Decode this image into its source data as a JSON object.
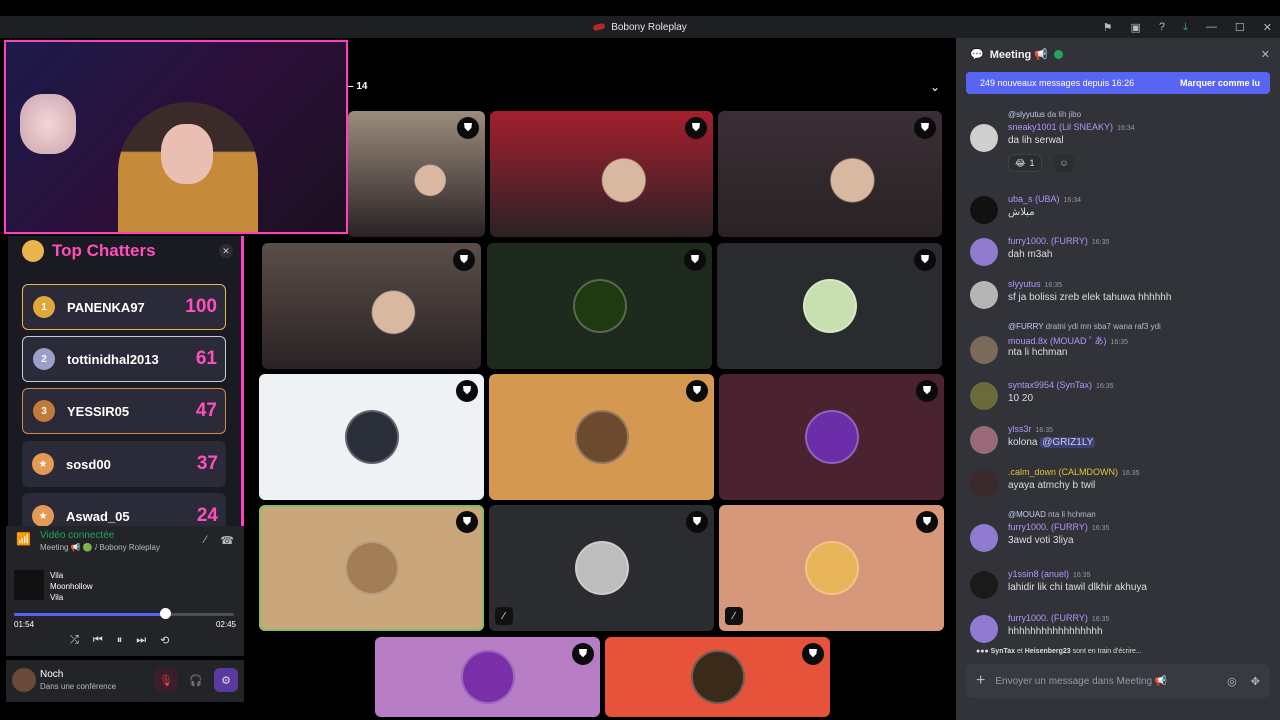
{
  "window": {
    "title": "Bobony Roleplay"
  },
  "stage": {
    "participant_count": "14",
    "tiles": [
      {
        "kind": "video",
        "bg": "#9b8c7d",
        "muted": false
      },
      {
        "kind": "video",
        "bg": "#a41f2e",
        "muted": false
      },
      {
        "kind": "video",
        "bg": "#3a2f36",
        "muted": false
      },
      {
        "kind": "video",
        "bg": "#5a4e48",
        "muted": false
      },
      {
        "kind": "avatar",
        "bg": "#1d2a1d",
        "avatar": "#1f3a10",
        "muted": false
      },
      {
        "kind": "avatar",
        "bg": "#2a2b2e",
        "avatar": "#c8e0b0",
        "muted": false
      },
      {
        "kind": "avatar",
        "bg": "#eef2f5",
        "avatar": "#2a2f3a",
        "muted": false
      },
      {
        "kind": "avatar",
        "bg": "#d49850",
        "avatar": "#6c4a2e",
        "muted": false
      },
      {
        "kind": "avatar",
        "bg": "#4a2230",
        "avatar": "#6b2ea8",
        "muted": false
      },
      {
        "kind": "avatar",
        "bg": "#c9a67c",
        "avatar": "#a27c54",
        "muted": false
      },
      {
        "kind": "avatar",
        "bg": "#2b2c30",
        "avatar": "#bdbdbd",
        "muted": true
      },
      {
        "kind": "avatar",
        "bg": "#d6977a",
        "avatar": "#e8b55a",
        "muted": true
      },
      {
        "kind": "avatar",
        "bg": "#b77dc4",
        "avatar": "#7a2ea8",
        "muted": false
      },
      {
        "kind": "avatar",
        "bg": "#e6523a",
        "avatar": "#3a2a1a",
        "muted": false
      }
    ]
  },
  "top_chatters": {
    "title": "Top Chatters",
    "rows": [
      {
        "rank": "1",
        "name": "PANENKA97",
        "score": "100",
        "tier": "gold"
      },
      {
        "rank": "2",
        "name": "tottinidhal2013",
        "score": "61",
        "tier": "silver"
      },
      {
        "rank": "3",
        "name": "YESSIR05",
        "score": "47",
        "tier": "bronze"
      },
      {
        "rank": "",
        "name": "sosd00",
        "score": "37",
        "tier": "none"
      },
      {
        "rank": "",
        "name": "Aswad_05",
        "score": "24",
        "tier": "none"
      }
    ]
  },
  "voice": {
    "status": "Vidéo connectée",
    "channel": "Meeting 📢 🟢 / Bobony Roleplay",
    "song_title": "Vila",
    "song_artist": "Moonhollow",
    "song_album": "Vila",
    "elapsed": "01:54",
    "duration": "02:45",
    "progress": 0.688
  },
  "user": {
    "name": "Noch",
    "status": "Dans une conférence"
  },
  "chat": {
    "channel": "Meeting 📢",
    "banner_text": "249 nouveaux messages depuis 16:26",
    "banner_action": "Marquer comme lu",
    "messages": [
      {
        "reply": "@slyyutus",
        "reply_text": "da lih jibo",
        "user": "sneaky1001 (Lil SNEAKY)",
        "time": "16:34",
        "text": "da lih serwal",
        "color": "#b495ff",
        "avatar": "#cfcfcf"
      },
      {
        "reply": "",
        "reply_text": "",
        "user": "uba_s (UBA)",
        "time": "16:34",
        "text": "مبلاش",
        "color": "#b495ff",
        "avatar": "#111111"
      },
      {
        "reply": "",
        "reply_text": "",
        "user": "furry1000. (FURRY)",
        "time": "16:35",
        "text": "dah m3ah",
        "color": "#b495ff",
        "avatar": "#8f7bd0"
      },
      {
        "reply": "",
        "reply_text": "",
        "user": "slyyutus",
        "time": "16:35",
        "text": "sf ja bolissi zreb elek tahuwa hhhhhh",
        "color": "#b495ff",
        "avatar": "#b5b5b5"
      },
      {
        "reply": "@FURRY",
        "reply_text": "dratni ydi mn sba7 wana raf3 ydi",
        "user": "mouad.8x (MOUAD ˚ あ)",
        "time": "16:35",
        "text": "nta li hchman",
        "color": "#b495ff",
        "avatar": "#7a6a5a"
      },
      {
        "reply": "",
        "reply_text": "",
        "user": "syntax9954 (SynTax)",
        "time": "16:35",
        "text": "10 20",
        "color": "#b495ff",
        "avatar": "#6a6a3a"
      },
      {
        "reply": "",
        "reply_text": "",
        "user": "ylss3r",
        "time": "16:35",
        "text": "kolona",
        "mention": "@GRIZ1LY",
        "color": "#b495ff",
        "avatar": "#9a6a7a"
      },
      {
        "reply": "",
        "reply_text": "",
        "user": ".calm_down (CALMDOWN)",
        "time": "16:35",
        "text": "ayaya atmchy b twil",
        "color": "#e3c33b",
        "avatar": "#3a2a2a"
      },
      {
        "reply": "@MOUAD",
        "reply_text": "nta li hchman",
        "user": "furry1000. (FURRY)",
        "time": "16:35",
        "text": "3awd voti 3liya",
        "color": "#b495ff",
        "avatar": "#8f7bd0"
      },
      {
        "reply": "",
        "reply_text": "",
        "user": "y1ssin8 (anuel)",
        "time": "16:35",
        "text": "lahidir lik chi tawil dlkhir akhuya",
        "color": "#b495ff",
        "avatar": "#1a1a1a"
      },
      {
        "reply": "",
        "reply_text": "",
        "user": "furry1000. (FURRY)",
        "time": "16:35",
        "text": "hhhhhhhhhhhhhhhhh",
        "color": "#b495ff",
        "avatar": "#8f7bd0"
      }
    ],
    "reaction_count": "1",
    "typing_users": "SynTax",
    "typing_and": "et",
    "typing_users2": "Heisenberg23",
    "typing_suffix": "sont en train d'écrire...",
    "composer_placeholder": "Envoyer un message dans Meeting 📢"
  }
}
